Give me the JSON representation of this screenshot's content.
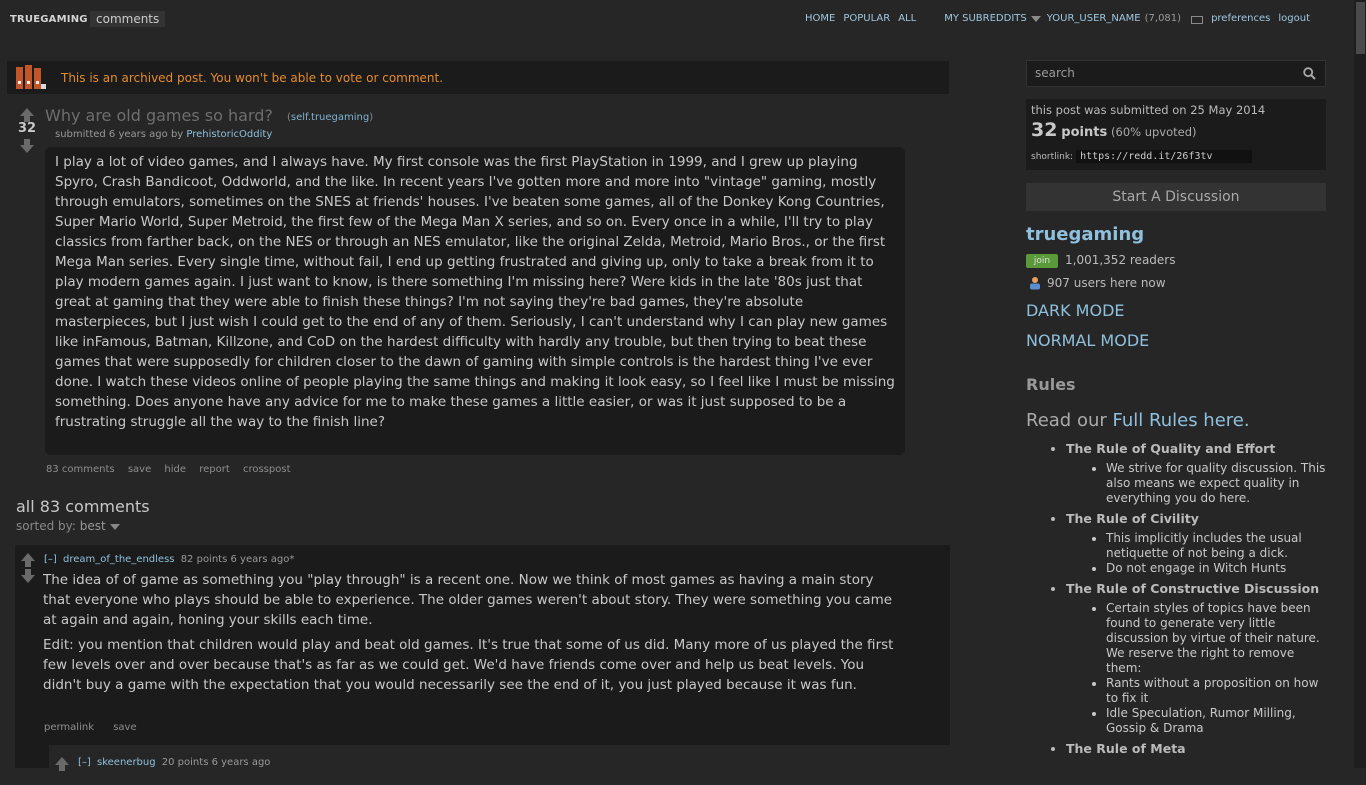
{
  "header": {
    "brand": "TRUEGAMING",
    "page_name": "comments",
    "nav": {
      "home": "HOME",
      "popular": "POPULAR",
      "all": "ALL",
      "my_subreddits": "MY SUBREDDITS",
      "username": "YOUR_USER_NAME",
      "karma": "(7,081)",
      "preferences": "preferences",
      "logout": "logout"
    }
  },
  "archived": {
    "text": "This is an archived post. You won't be able to vote or comment."
  },
  "post": {
    "score": "32",
    "title": "Why are old games so hard?",
    "domain_open": "(",
    "domain": "self.truegaming",
    "domain_close": ")",
    "submitted_prefix": "submitted 6 years ago by",
    "author": "PrehistoricOddity",
    "body": "I play a lot of video games, and I always have. My first console was the first PlayStation in 1999, and I grew up playing Spyro, Crash Bandicoot, Oddworld, and the like. In recent years I've gotten more and more into \"vintage\" gaming, mostly through emulators, sometimes on the SNES at friends' houses. I've beaten some games, all of the Donkey Kong Countries, Super Mario World, Super Metroid, the first few of the Mega Man X series, and so on. Every once in a while, I'll try to play classics from farther back, on the NES or through an NES emulator, like the original Zelda, Metroid, Mario Bros., or the first Mega Man series. Every single time, without fail, I end up getting frustrated and giving up, only to take a break from it to play modern games again. I just want to know, is there something I'm missing here? Were kids in the late '80s just that great at gaming that they were able to finish these things? I'm not saying they're bad games, they're absolute masterpieces, but I just wish I could get to the end of any of them. Seriously, I can't understand why I can play new games like inFamous, Batman, Killzone, and CoD on the hardest difficulty with hardly any trouble, but then trying to beat these games that were supposedly for children closer to the dawn of gaming with simple controls is the hardest thing I've ever done. I watch these videos online of people playing the same things and making it look easy, so I feel like I must be missing something. Does anyone have any advice for me to make these games a little easier, or was it just supposed to be a frustrating struggle all the way to the finish line?",
    "actions": {
      "comments": "83 comments",
      "save": "save",
      "hide": "hide",
      "report": "report",
      "crosspost": "crosspost"
    }
  },
  "comments_section": {
    "title": "all 83 comments",
    "sorted_label": "sorted by:",
    "sorted_value": "best"
  },
  "comments": [
    {
      "toggle": "[–]",
      "author": "dream_of_the_endless",
      "meta": "82 points 6 years ago*",
      "paragraphs": [
        "The idea of of game as something you \"play through\" is a recent one. Now we think of most games as having a main story that everyone who plays should be able to experience. The older games weren't about story. They were something you came at again and again, honing your skills each time.",
        "Edit: you mention that children would play and beat old games. It's true that some of us did. Many more of us played the first few levels over and over because that's as far as we could get. We'd have friends come over and help us beat levels. You didn't buy a game with the expectation that you would necessarily see the end of it, you just played because it was fun."
      ],
      "actions": {
        "permalink": "permalink",
        "save": "save"
      },
      "child": {
        "toggle": "[–]",
        "author": "skeenerbug",
        "meta": "20 points 6 years ago"
      }
    }
  ],
  "sidebar": {
    "search_placeholder": "search",
    "info": {
      "submitted": "this post was submitted on 25 May 2014",
      "points_value": "32",
      "points_word": "points",
      "upvoted": "(60% upvoted)",
      "shortlink_label": "shortlink:",
      "shortlink": "https://redd.it/26f3tv"
    },
    "start_discussion": "Start A Discussion",
    "subreddit": "truegaming",
    "join": "join",
    "readers": "1,001,352 readers",
    "online": "907 users here now",
    "dark_mode": "DARK MODE",
    "normal_mode": "NORMAL MODE",
    "rules_heading": "Rules",
    "read_our": "Read our",
    "full_rules": "Full Rules here.",
    "rules": [
      {
        "title": "The Rule of Quality and Effort",
        "items": [
          "We strive for quality discussion. This also means we expect quality in everything you do here."
        ]
      },
      {
        "title": "The Rule of Civility",
        "items": [
          "This implicitly includes the usual netiquette of not being a dick.",
          "Do not engage in Witch Hunts"
        ]
      },
      {
        "title": "The Rule of Constructive Discussion",
        "items": [
          "Certain styles of topics have been found to generate very little discussion by virtue of their nature. We reserve the right to remove them:",
          "Rants without a proposition on how to fix it",
          "Idle Speculation, Rumor Milling, Gossip & Drama"
        ]
      },
      {
        "title": "The Rule of Meta",
        "items": []
      }
    ]
  },
  "colors": {
    "background": "#262626",
    "panel": "#1b1b1b",
    "link": "#8fc0dd",
    "archived_text": "#e58b2c",
    "join": "#5b9a3b"
  }
}
